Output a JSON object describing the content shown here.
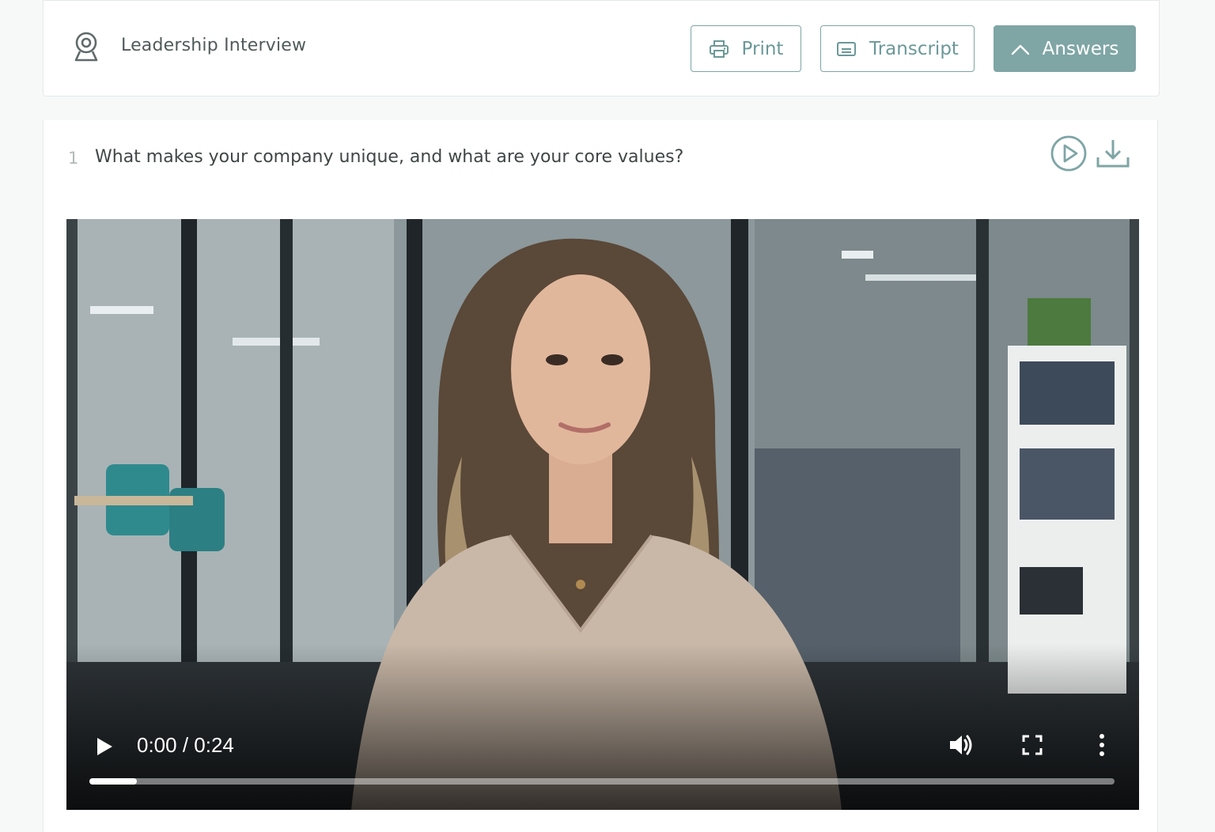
{
  "header": {
    "title": "Leadership Interview",
    "icon": "webcam-icon",
    "buttons": {
      "print_label": "Print",
      "transcript_label": "Transcript",
      "answers_label": "Answers"
    }
  },
  "question": {
    "number": "1",
    "text": "What makes your company unique, and what are your core values?"
  },
  "video": {
    "time_display": "0:00 / 0:24",
    "progress_fraction": 0.046
  },
  "colors": {
    "accent": "#7fa5a5",
    "accent_text": "#6b9898",
    "page_background": "#f7f8f8"
  }
}
